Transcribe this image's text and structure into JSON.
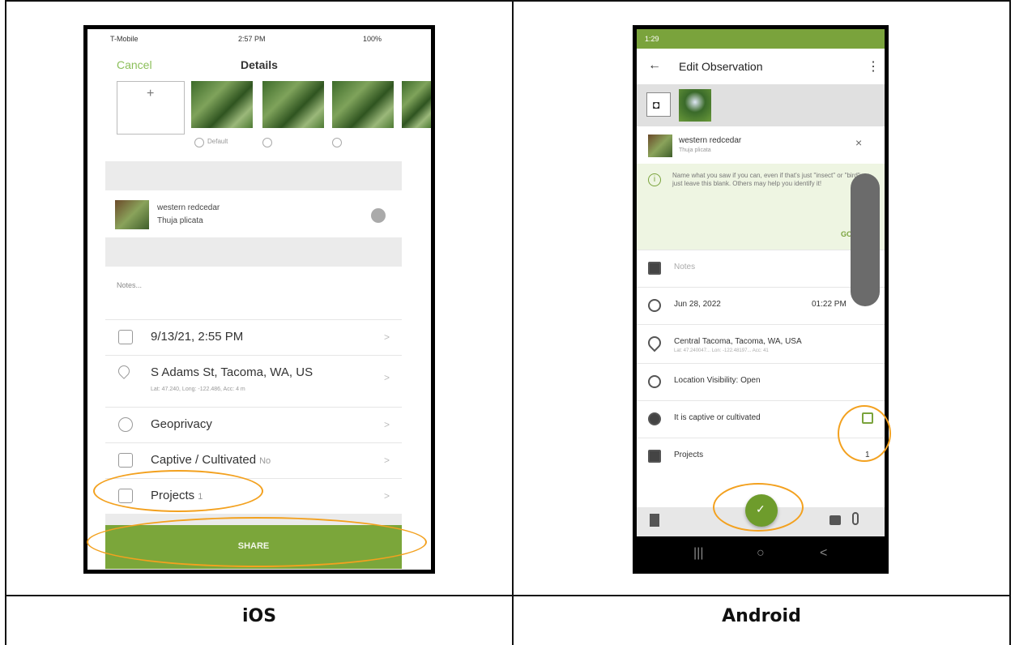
{
  "captions": {
    "left": "iOS",
    "right": "Android"
  },
  "ios": {
    "status": {
      "carrier": "T-Mobile",
      "time": "2:57 PM",
      "battery": "100%"
    },
    "nav": {
      "cancel": "Cancel",
      "title": "Details"
    },
    "photos": {
      "add": "+",
      "default_label": "Default"
    },
    "species": {
      "common_name": "western redcedar",
      "scientific_name": "Thuja plicata"
    },
    "notes_placeholder": "Notes...",
    "rows": [
      {
        "label": "9/13/21, 2:55 PM",
        "sub": "",
        "value": ""
      },
      {
        "label": "S Adams St, Tacoma, WA, US",
        "sub": "Lat: 47.240, Long: -122.486, Acc: 4 m",
        "value": ""
      },
      {
        "label": "Geoprivacy",
        "sub": "",
        "value": ""
      },
      {
        "label": "Captive / Cultivated",
        "sub": "",
        "value": "No"
      },
      {
        "label": "Projects",
        "sub": "",
        "value": "1"
      }
    ],
    "chevron": ">",
    "share_label": "SHARE"
  },
  "android": {
    "status": {
      "time": "1:29"
    },
    "appbar": {
      "back": "←",
      "title": "Edit Observation",
      "menu": "⋮"
    },
    "species": {
      "common_name": "western redcedar",
      "scientific_name": "Thuja plicata",
      "close": "×"
    },
    "tip": {
      "text": "Name what you saw if you can, even if that's just \"insect\" or \"bird\", or just leave this blank. Others may help you identify it!",
      "action": "GOT IT"
    },
    "notes_placeholder": "Notes",
    "date": "Jun 28, 2022",
    "time": "01:22 PM",
    "location": {
      "name": "Central Tacoma, Tacoma, WA, USA",
      "sub": "Lat: 47.240047... Lon: -122.48197... Acc: 41"
    },
    "visibility": "Location Visibility: Open",
    "captive": "It is captive or cultivated",
    "projects": {
      "label": "Projects",
      "count": "1"
    },
    "fab": "✓",
    "nav": {
      "recents": "|||",
      "home": "○",
      "back": "<"
    }
  },
  "colors": {
    "accent_green": "#7ba63a",
    "highlight_orange": "#f3a11f"
  }
}
